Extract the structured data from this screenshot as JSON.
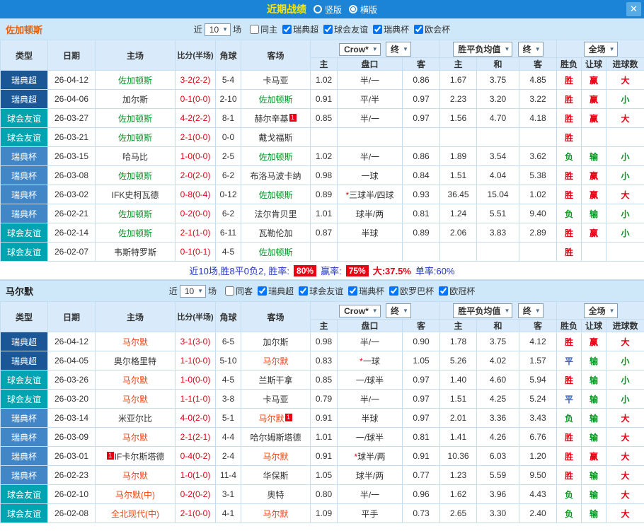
{
  "titlebar": {
    "title": "近期战绩",
    "radio_options": [
      {
        "label": "竖版",
        "selected": false
      },
      {
        "label": "横版",
        "selected": true
      }
    ],
    "close": "✕"
  },
  "columns": {
    "type": "类型",
    "date": "日期",
    "home": "主场",
    "score": "比分(半场)",
    "corner": "角球",
    "away": "客场",
    "odds_home": "主",
    "handicap": "盘口",
    "odds_away": "客",
    "avg_home": "主",
    "avg_draw": "和",
    "avg_away": "客",
    "result": "胜负",
    "handicap_result": "让球",
    "goals": "进球数"
  },
  "league_colors": {
    "瑞典超": "#1b5796",
    "球会友谊": "#00a4b0",
    "瑞典杯": "#4186c7"
  },
  "value_colors": {
    "胜": "#e60012",
    "平": "#3b5fc4",
    "负": "#00971d",
    "赢": "#e60012",
    "输": "#00971d",
    "大": "#e60012",
    "小": "#00971d"
  },
  "sections": [
    {
      "team": "佐加顿斯",
      "team_label_color": "#e8610a",
      "highlight_color": "#009423",
      "filters": {
        "near_label": "近",
        "count": "10",
        "games_label": "场",
        "checkboxes": [
          {
            "label": "同主",
            "checked": false
          },
          {
            "label": "瑞典超",
            "checked": true
          },
          {
            "label": "球会友谊",
            "checked": true
          },
          {
            "label": "瑞典杯",
            "checked": true
          },
          {
            "label": "欧会杯",
            "checked": true
          }
        ]
      },
      "dropdowns": {
        "company": "Crow*",
        "company_stage": "终",
        "avg": "胜平负均值",
        "avg_stage": "终",
        "scope": "全场"
      },
      "rows": [
        {
          "type": "瑞典超",
          "date": "26-04-12",
          "home": "佐加顿斯",
          "home_hl": true,
          "score": "3-2(2-2)",
          "corner": "5-4",
          "away": "卡马亚",
          "away_hl": false,
          "o1": "1.02",
          "hcp": "半/一",
          "star": false,
          "o2": "0.86",
          "a1": "1.67",
          "a2": "3.75",
          "a3": "4.85",
          "res": "胜",
          "hres": "赢",
          "goal": "大"
        },
        {
          "type": "瑞典超",
          "date": "26-04-06",
          "home": "加尔斯",
          "home_hl": false,
          "score": "0-1(0-0)",
          "corner": "2-10",
          "away": "佐加顿斯",
          "away_hl": true,
          "o1": "0.91",
          "hcp": "平/半",
          "star": false,
          "o2": "0.97",
          "a1": "2.23",
          "a2": "3.20",
          "a3": "3.22",
          "res": "胜",
          "hres": "赢",
          "goal": "小"
        },
        {
          "type": "球会友谊",
          "date": "26-03-27",
          "home": "佐加顿斯",
          "home_hl": true,
          "score": "4-2(2-2)",
          "corner": "8-1",
          "away": "赫尔辛基",
          "away_hl": false,
          "away_card": "1",
          "o1": "0.85",
          "hcp": "半/一",
          "star": false,
          "o2": "0.97",
          "a1": "1.56",
          "a2": "4.70",
          "a3": "4.18",
          "res": "胜",
          "hres": "赢",
          "goal": "大"
        },
        {
          "type": "球会友谊",
          "date": "26-03-21",
          "home": "佐加顿斯",
          "home_hl": true,
          "score": "2-1(0-0)",
          "corner": "0-0",
          "away": "戴戈福斯",
          "away_hl": false,
          "o1": "",
          "hcp": "",
          "star": false,
          "o2": "",
          "a1": "",
          "a2": "",
          "a3": "",
          "res": "胜",
          "hres": "",
          "goal": ""
        },
        {
          "type": "瑞典杯",
          "date": "26-03-15",
          "home": "哈马比",
          "home_hl": false,
          "score": "1-0(0-0)",
          "corner": "2-5",
          "away": "佐加顿斯",
          "away_hl": true,
          "o1": "1.02",
          "hcp": "半/一",
          "star": false,
          "o2": "0.86",
          "a1": "1.89",
          "a2": "3.54",
          "a3": "3.62",
          "res": "负",
          "hres": "输",
          "goal": "小"
        },
        {
          "type": "瑞典杯",
          "date": "26-03-08",
          "home": "佐加顿斯",
          "home_hl": true,
          "score": "2-0(2-0)",
          "corner": "6-2",
          "away": "布洛马波卡纳",
          "away_hl": false,
          "o1": "0.98",
          "hcp": "一球",
          "star": false,
          "o2": "0.84",
          "a1": "1.51",
          "a2": "4.04",
          "a3": "5.38",
          "res": "胜",
          "hres": "赢",
          "goal": "小"
        },
        {
          "type": "瑞典杯",
          "date": "26-03-02",
          "home": "IFK史柯瓦德",
          "home_hl": false,
          "score": "0-8(0-4)",
          "corner": "0-12",
          "away": "佐加顿斯",
          "away_hl": true,
          "o1": "0.89",
          "hcp": "三球半/四球",
          "star": true,
          "o2": "0.93",
          "a1": "36.45",
          "a2": "15.04",
          "a3": "1.02",
          "res": "胜",
          "hres": "赢",
          "goal": "大"
        },
        {
          "type": "瑞典杯",
          "date": "26-02-21",
          "home": "佐加顿斯",
          "home_hl": true,
          "score": "0-2(0-0)",
          "corner": "6-2",
          "away": "法尔肯贝里",
          "away_hl": false,
          "o1": "1.01",
          "hcp": "球半/两",
          "star": false,
          "o2": "0.81",
          "a1": "1.24",
          "a2": "5.51",
          "a3": "9.40",
          "res": "负",
          "hres": "输",
          "goal": "小"
        },
        {
          "type": "球会友谊",
          "date": "26-02-14",
          "home": "佐加顿斯",
          "home_hl": true,
          "score": "2-1(1-0)",
          "corner": "6-11",
          "away": "瓦勒伦加",
          "away_hl": false,
          "o1": "0.87",
          "hcp": "半球",
          "star": false,
          "o2": "0.89",
          "a1": "2.06",
          "a2": "3.83",
          "a3": "2.89",
          "res": "胜",
          "hres": "赢",
          "goal": "小"
        },
        {
          "type": "球会友谊",
          "date": "26-02-07",
          "home": "韦斯特罗斯",
          "home_hl": false,
          "score": "0-1(0-1)",
          "corner": "4-5",
          "away": "佐加顿斯",
          "away_hl": true,
          "o1": "",
          "hcp": "",
          "star": false,
          "o2": "",
          "a1": "",
          "a2": "",
          "a3": "",
          "res": "胜",
          "hres": "",
          "goal": ""
        }
      ],
      "summary": {
        "prefix": "近10场,胜8平0负2, 胜率:",
        "win_rate": "80%",
        "hcp_label": "赢率:",
        "hcp_rate": "75%",
        "big_rate": "大:37.5%",
        "single_rate": "单率:60%"
      }
    },
    {
      "team": "马尔默",
      "team_label_color": "#222222",
      "highlight_color": "#ee4411",
      "filters": {
        "near_label": "近",
        "count": "10",
        "games_label": "场",
        "checkboxes": [
          {
            "label": "同客",
            "checked": false
          },
          {
            "label": "瑞典超",
            "checked": true
          },
          {
            "label": "球会友谊",
            "checked": true
          },
          {
            "label": "瑞典杯",
            "checked": true
          },
          {
            "label": "欧罗巴杯",
            "checked": true
          },
          {
            "label": "欧冠杯",
            "checked": true
          }
        ]
      },
      "dropdowns": {
        "company": "Crow*",
        "company_stage": "终",
        "avg": "胜平负均值",
        "avg_stage": "终",
        "scope": "全场"
      },
      "rows": [
        {
          "type": "瑞典超",
          "date": "26-04-12",
          "home": "马尔默",
          "home_hl": true,
          "score": "3-1(3-0)",
          "corner": "6-5",
          "away": "加尔斯",
          "away_hl": false,
          "o1": "0.98",
          "hcp": "半/一",
          "star": false,
          "o2": "0.90",
          "a1": "1.78",
          "a2": "3.75",
          "a3": "4.12",
          "res": "胜",
          "hres": "赢",
          "goal": "大"
        },
        {
          "type": "瑞典超",
          "date": "26-04-05",
          "home": "奥尔格里特",
          "home_hl": false,
          "score": "1-1(0-0)",
          "corner": "5-10",
          "away": "马尔默",
          "away_hl": true,
          "o1": "0.83",
          "hcp": "一球",
          "star": true,
          "o2": "1.05",
          "a1": "5.26",
          "a2": "4.02",
          "a3": "1.57",
          "res": "平",
          "hres": "输",
          "goal": "小"
        },
        {
          "type": "球会友谊",
          "date": "26-03-26",
          "home": "马尔默",
          "home_hl": true,
          "score": "1-0(0-0)",
          "corner": "4-5",
          "away": "兰斯干拿",
          "away_hl": false,
          "o1": "0.85",
          "hcp": "一/球半",
          "star": false,
          "o2": "0.97",
          "a1": "1.40",
          "a2": "4.60",
          "a3": "5.94",
          "res": "胜",
          "hres": "输",
          "goal": "小"
        },
        {
          "type": "球会友谊",
          "date": "26-03-20",
          "home": "马尔默",
          "home_hl": true,
          "score": "1-1(1-0)",
          "corner": "3-8",
          "away": "卡马亚",
          "away_hl": false,
          "o1": "0.79",
          "hcp": "半/一",
          "star": false,
          "o2": "0.97",
          "a1": "1.51",
          "a2": "4.25",
          "a3": "5.24",
          "res": "平",
          "hres": "输",
          "goal": "小"
        },
        {
          "type": "瑞典杯",
          "date": "26-03-14",
          "home": "米亚尔比",
          "home_hl": false,
          "score": "4-0(2-0)",
          "corner": "5-1",
          "away": "马尔默",
          "away_hl": true,
          "away_card": "1",
          "o1": "0.91",
          "hcp": "半球",
          "star": false,
          "o2": "0.97",
          "a1": "2.01",
          "a2": "3.36",
          "a3": "3.43",
          "res": "负",
          "hres": "输",
          "goal": "大"
        },
        {
          "type": "瑞典杯",
          "date": "26-03-09",
          "home": "马尔默",
          "home_hl": true,
          "score": "2-1(2-1)",
          "corner": "4-4",
          "away": "哈尔姆斯塔德",
          "away_hl": false,
          "o1": "1.01",
          "hcp": "一/球半",
          "star": false,
          "o2": "0.81",
          "a1": "1.41",
          "a2": "4.26",
          "a3": "6.76",
          "res": "胜",
          "hres": "输",
          "goal": "大"
        },
        {
          "type": "瑞典杯",
          "date": "26-03-01",
          "home": "IF卡尔斯塔德",
          "home_hl": false,
          "home_card": "1",
          "home_card_before": true,
          "score": "0-4(0-2)",
          "corner": "2-4",
          "away": "马尔默",
          "away_hl": true,
          "o1": "0.91",
          "hcp": "球半/两",
          "star": true,
          "o2": "0.91",
          "a1": "10.36",
          "a2": "6.03",
          "a3": "1.20",
          "res": "胜",
          "hres": "赢",
          "goal": "大"
        },
        {
          "type": "瑞典杯",
          "date": "26-02-23",
          "home": "马尔默",
          "home_hl": true,
          "score": "1-0(1-0)",
          "corner": "11-4",
          "away": "华保斯",
          "away_hl": false,
          "o1": "1.05",
          "hcp": "球半/两",
          "star": false,
          "o2": "0.77",
          "a1": "1.23",
          "a2": "5.59",
          "a3": "9.50",
          "res": "胜",
          "hres": "输",
          "goal": "大"
        },
        {
          "type": "球会友谊",
          "date": "26-02-10",
          "home": "马尔默(中)",
          "home_hl": true,
          "score": "0-2(0-2)",
          "corner": "3-1",
          "away": "奥特",
          "away_hl": false,
          "o1": "0.80",
          "hcp": "半/一",
          "star": false,
          "o2": "0.96",
          "a1": "1.62",
          "a2": "3.96",
          "a3": "4.43",
          "res": "负",
          "hres": "输",
          "goal": "大"
        },
        {
          "type": "球会友谊",
          "date": "26-02-08",
          "home": "全北现代(中)",
          "home_hl": true,
          "score": "2-1(0-0)",
          "corner": "4-1",
          "away": "马尔默",
          "away_hl": true,
          "o1": "1.09",
          "hcp": "平手",
          "star": false,
          "o2": "0.73",
          "a1": "2.65",
          "a2": "3.30",
          "a3": "2.40",
          "res": "负",
          "hres": "输",
          "goal": "大"
        }
      ],
      "summary": null
    }
  ]
}
